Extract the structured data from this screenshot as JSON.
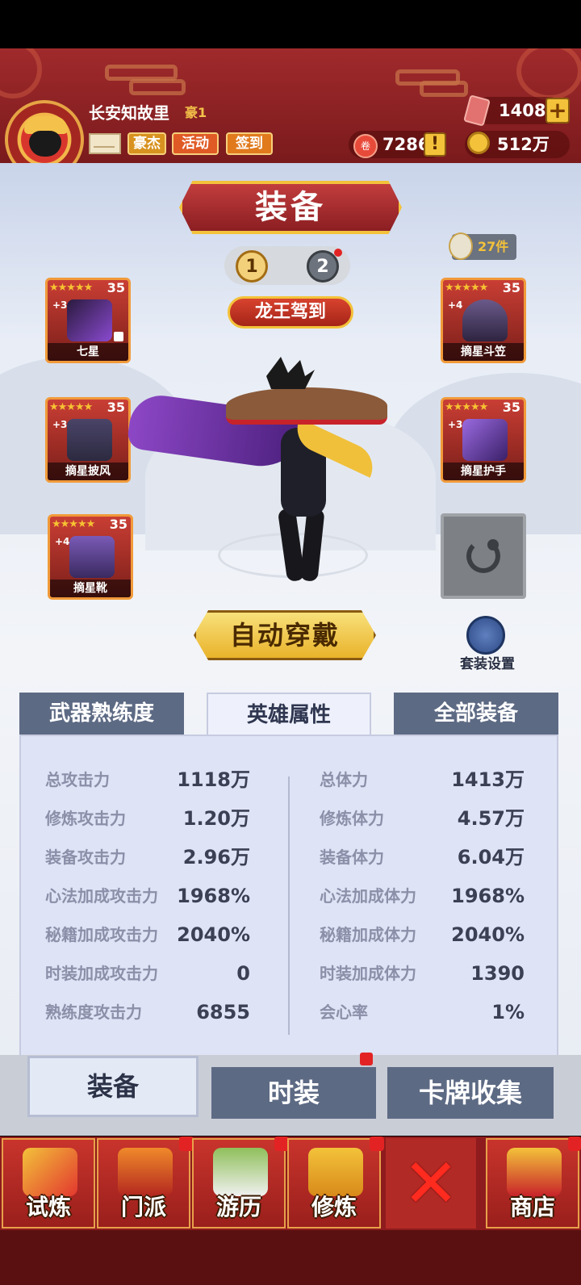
{
  "player": {
    "name": "长安知故里",
    "vip": "豪1"
  },
  "top_buttons": {
    "haojie": "豪杰",
    "activity": "活动",
    "signin": "签到"
  },
  "resources": {
    "gems": "1408",
    "coupons": "7286",
    "coupon_icon_text": "卷",
    "gold": "512万"
  },
  "header": {
    "title": "装备"
  },
  "page_switch": {
    "page1": "1",
    "page2": "2"
  },
  "item_count": "27件",
  "set_name": "龙王驾到",
  "slots": [
    {
      "name": "七星",
      "stars": "★★★★★",
      "level": "35",
      "plus": "+3",
      "color": "#7e3fc2"
    },
    {
      "name": "摘星披风",
      "stars": "★★★★★",
      "level": "35",
      "plus": "+3",
      "color": "#3e3b5a"
    },
    {
      "name": "摘星靴",
      "stars": "★★★★★",
      "level": "35",
      "plus": "+4",
      "color": "#6a4aa0"
    },
    {
      "name": "摘星斗笠",
      "stars": "★★★★★",
      "level": "35",
      "plus": "+4",
      "color": "#5a4a7a"
    },
    {
      "name": "摘星护手",
      "stars": "★★★★★",
      "level": "35",
      "plus": "+3",
      "color": "#7a4ab6"
    }
  ],
  "actions": {
    "auto_equip": "自动穿戴",
    "set_config": "套装设置"
  },
  "tabs": {
    "weapon": "武器熟练度",
    "attributes": "英雄属性",
    "all_equipment": "全部装备"
  },
  "stats_left": [
    {
      "label": "总攻击力",
      "value": "1118万"
    },
    {
      "label": "修炼攻击力",
      "value": "1.20万"
    },
    {
      "label": "装备攻击力",
      "value": "2.96万"
    },
    {
      "label": "心法加成攻击力",
      "value": "1968%"
    },
    {
      "label": "秘籍加成攻击力",
      "value": "2040%"
    },
    {
      "label": "时装加成攻击力",
      "value": "0"
    },
    {
      "label": "熟练度攻击力",
      "value": "6855"
    }
  ],
  "stats_right": [
    {
      "label": "总体力",
      "value": "1413万"
    },
    {
      "label": "修炼体力",
      "value": "4.57万"
    },
    {
      "label": "装备体力",
      "value": "6.04万"
    },
    {
      "label": "心法加成体力",
      "value": "1968%"
    },
    {
      "label": "秘籍加成体力",
      "value": "2040%"
    },
    {
      "label": "时装加成体力",
      "value": "1390"
    },
    {
      "label": "会心率",
      "value": "1%"
    }
  ],
  "bottom_tabs": {
    "equipment": "装备",
    "fashion": "时装",
    "cards": "卡牌收集"
  },
  "nav": {
    "trial": "试炼",
    "sect": "门派",
    "travel": "游历",
    "cultivate": "修炼",
    "shop": "商店"
  }
}
